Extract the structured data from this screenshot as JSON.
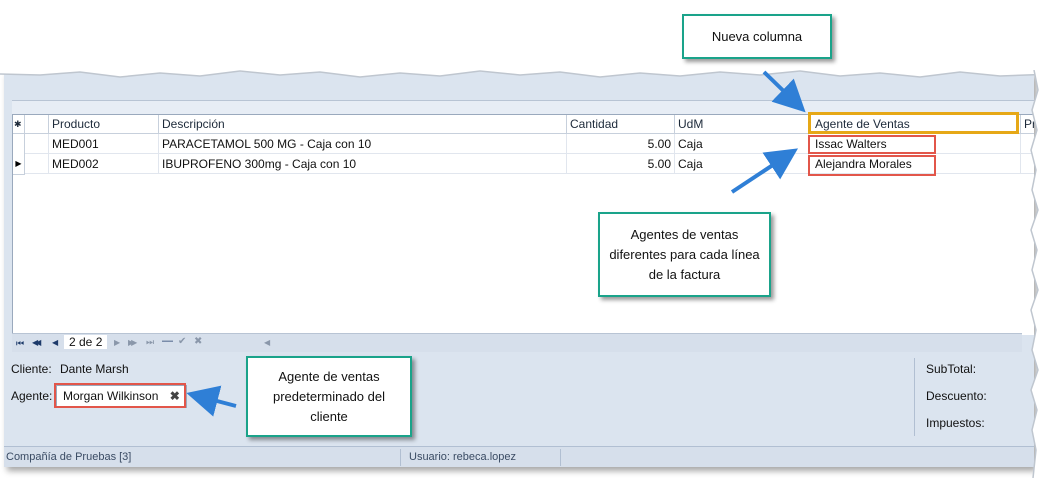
{
  "grid": {
    "columns": [
      "Producto",
      "Descripción",
      "Cantidad",
      "UdM",
      "Agente de Ventas",
      "Pre"
    ],
    "rows": [
      {
        "producto": "MED001",
        "descripcion": "PARACETAMOL 500 MG - Caja con 10",
        "cantidad": "5.00",
        "udm": "Caja",
        "agente": "Issac Walters"
      },
      {
        "producto": "MED002",
        "descripcion": "IBUPROFENO 300mg - Caja con 10",
        "cantidad": "5.00",
        "udm": "Caja",
        "agente": "Alejandra Morales"
      }
    ],
    "header_marker": "✱",
    "current_row_marker": "▶"
  },
  "navigator": {
    "first": "⏮",
    "prev_page": "◀◀",
    "prev": "◀",
    "position": "2 de 2",
    "next": "▶",
    "next_page": "▶▶",
    "last": "⏭",
    "delete": "—",
    "accept": "✔",
    "cancel": "✖"
  },
  "footer": {
    "cliente_label": "Cliente:",
    "cliente_value": "Dante Marsh",
    "agente_label": "Agente:",
    "agente_value": "Morgan Wilkinson",
    "clear_icon": "✖",
    "subtotal_label": "SubTotal:",
    "descuento_label": "Descuento:",
    "impuestos_label": "Impuestos:"
  },
  "status": {
    "company": "Compañía de Pruebas [3]",
    "user": "Usuario: rebeca.lopez"
  },
  "callouts": {
    "nueva_columna": "Nueva columna",
    "agentes_linea": "Agentes de ventas diferentes para cada línea de la factura",
    "agente_predeterminado": "Agente de ventas predeterminado del cliente"
  },
  "colors": {
    "callout_border": "#1aa38a",
    "highlight_red": "#e2564a",
    "highlight_gold": "#e6a817",
    "arrow_blue": "#2f7fd6"
  }
}
